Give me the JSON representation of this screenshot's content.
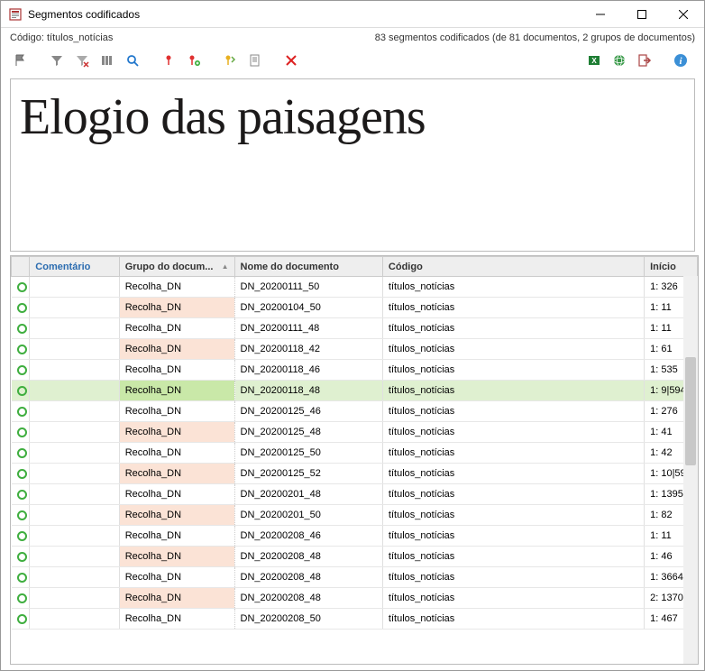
{
  "window": {
    "title": "Segmentos codificados"
  },
  "info": {
    "code_label": "Código: títulos_notícias",
    "summary": "83 segmentos codificados (de 81 documentos, 2 grupos de documentos)"
  },
  "preview": {
    "text": "Elogio das paisagens"
  },
  "columns": {
    "mark": "",
    "comentario": "Comentário",
    "grupo": "Grupo do docum...",
    "nome": "Nome do documento",
    "codigo": "Código",
    "inicio": "Início"
  },
  "rows": [
    {
      "grupo": "Recolha_DN",
      "nome": "DN_20200111_50",
      "codigo": "títulos_notícias",
      "inicio": "1: 326",
      "sel": false
    },
    {
      "grupo": "Recolha_DN",
      "nome": "DN_20200104_50",
      "codigo": "títulos_notícias",
      "inicio": "1: 11",
      "sel": false
    },
    {
      "grupo": "Recolha_DN",
      "nome": "DN_20200111_48",
      "codigo": "títulos_notícias",
      "inicio": "1: 11",
      "sel": false
    },
    {
      "grupo": "Recolha_DN",
      "nome": "DN_20200118_42",
      "codigo": "títulos_notícias",
      "inicio": "1: 61",
      "sel": false
    },
    {
      "grupo": "Recolha_DN",
      "nome": "DN_20200118_46",
      "codigo": "títulos_notícias",
      "inicio": "1: 535",
      "sel": false
    },
    {
      "grupo": "Recolha_DN",
      "nome": "DN_20200118_48",
      "codigo": "títulos_notícias",
      "inicio": "1: 9|594",
      "sel": true
    },
    {
      "grupo": "Recolha_DN",
      "nome": "DN_20200125_46",
      "codigo": "títulos_notícias",
      "inicio": "1: 276",
      "sel": false
    },
    {
      "grupo": "Recolha_DN",
      "nome": "DN_20200125_48",
      "codigo": "títulos_notícias",
      "inicio": "1: 41",
      "sel": false
    },
    {
      "grupo": "Recolha_DN",
      "nome": "DN_20200125_50",
      "codigo": "títulos_notícias",
      "inicio": "1: 42",
      "sel": false
    },
    {
      "grupo": "Recolha_DN",
      "nome": "DN_20200125_52",
      "codigo": "títulos_notícias",
      "inicio": "1: 10|59",
      "sel": false
    },
    {
      "grupo": "Recolha_DN",
      "nome": "DN_20200201_48",
      "codigo": "títulos_notícias",
      "inicio": "1: 1395",
      "sel": false
    },
    {
      "grupo": "Recolha_DN",
      "nome": "DN_20200201_50",
      "codigo": "títulos_notícias",
      "inicio": "1: 82",
      "sel": false
    },
    {
      "grupo": "Recolha_DN",
      "nome": "DN_20200208_46",
      "codigo": "títulos_notícias",
      "inicio": "1: 11",
      "sel": false
    },
    {
      "grupo": "Recolha_DN",
      "nome": "DN_20200208_48",
      "codigo": "títulos_notícias",
      "inicio": "1: 46",
      "sel": false
    },
    {
      "grupo": "Recolha_DN",
      "nome": "DN_20200208_48",
      "codigo": "títulos_notícias",
      "inicio": "1: 3664",
      "sel": false
    },
    {
      "grupo": "Recolha_DN",
      "nome": "DN_20200208_48",
      "codigo": "títulos_notícias",
      "inicio": "2: 1370",
      "sel": false
    },
    {
      "grupo": "Recolha_DN",
      "nome": "DN_20200208_50",
      "codigo": "títulos_notícias",
      "inicio": "1: 467",
      "sel": false
    }
  ]
}
